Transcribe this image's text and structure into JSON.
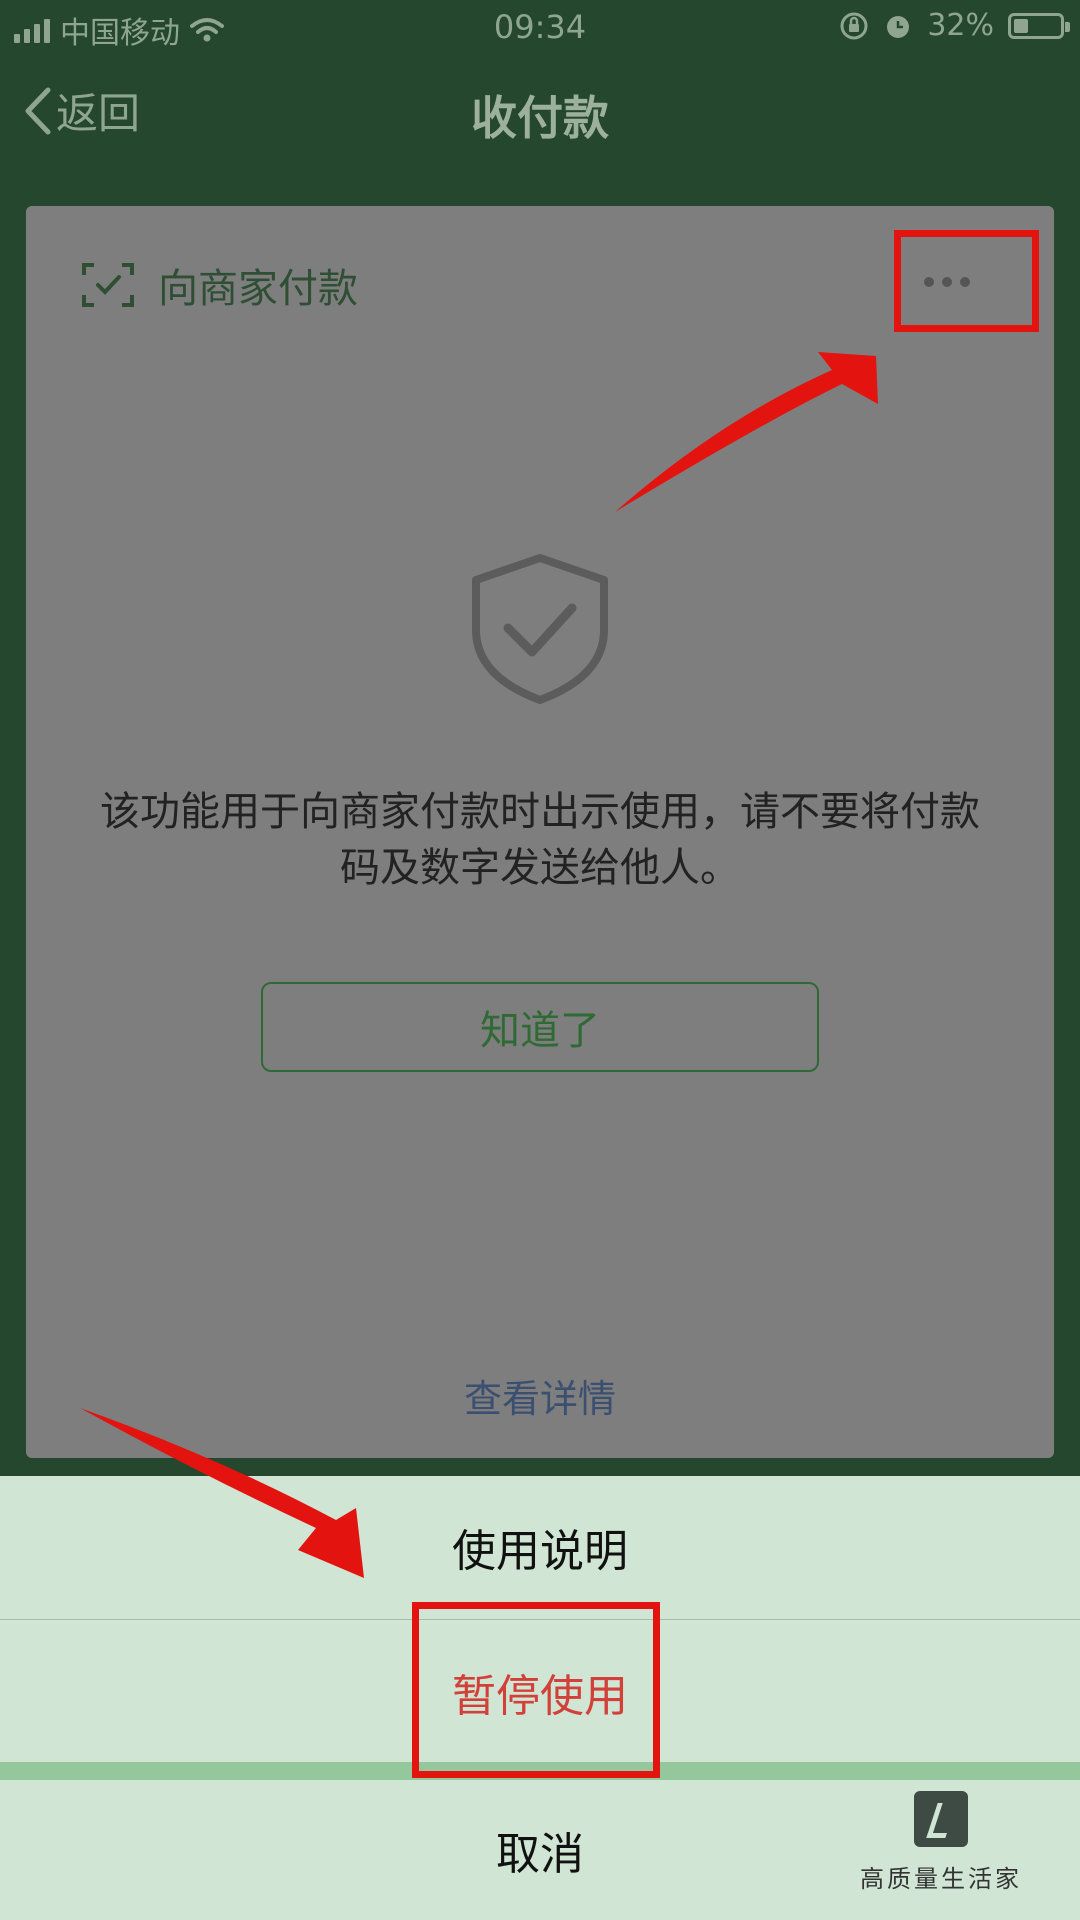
{
  "status_bar": {
    "carrier": "中国移动",
    "time": "09:34",
    "battery_percent": "32%",
    "battery_level": 0.32,
    "icons": [
      "signal-icon",
      "wifi-icon",
      "rotation-lock-icon",
      "alarm-icon",
      "battery-icon"
    ]
  },
  "nav": {
    "back_label": "返回",
    "title": "收付款"
  },
  "card": {
    "header_title": "向商家付款",
    "header_icon": "scan-pay-icon",
    "more_icon": "more-dots-icon",
    "shield_icon": "shield-check-icon",
    "message": "该功能用于向商家付款时出示使用，请不要将付款码及数字发送给他人。",
    "ok_label": "知道了",
    "details_label": "查看详情"
  },
  "action_sheet": {
    "items": [
      {
        "label": "使用说明"
      },
      {
        "label": "暂停使用",
        "color": "#d2403a"
      }
    ],
    "cancel_label": "取消"
  },
  "annotations": {
    "color": "#e3130f"
  },
  "watermark": {
    "text": "高质量生活家"
  },
  "colors": {
    "header_bg": "#24472d",
    "card_bg": "#7e7e7e",
    "accent_green": "#2f6a35",
    "sheet_bg": "#d0e5d4"
  }
}
